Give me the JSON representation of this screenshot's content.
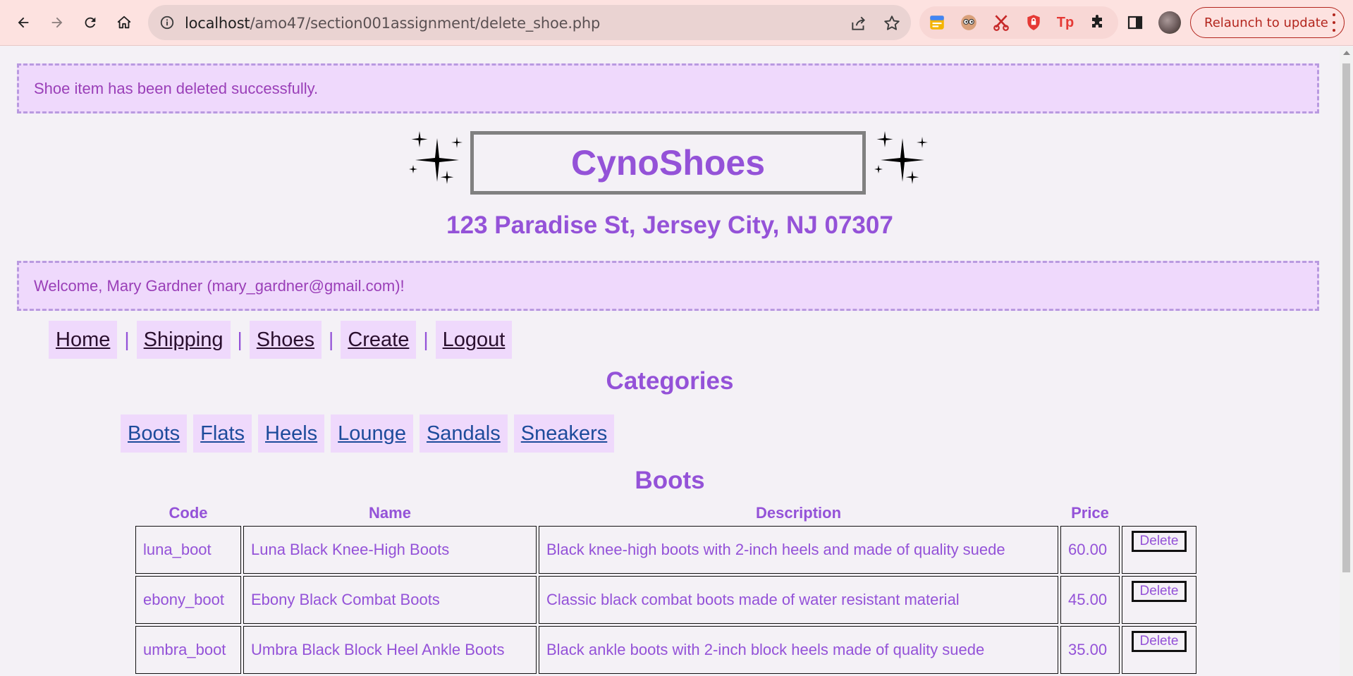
{
  "browser": {
    "url_host": "localhost",
    "url_path": "/amo47/section001assignment/delete_shoe.php",
    "relaunch_label": "Relaunch to update"
  },
  "notice": {
    "success": "Shoe item has been deleted successfully.",
    "welcome": "Welcome, Mary Gardner (mary_gardner@gmail.com)!"
  },
  "brand": {
    "name": "CynoShoes",
    "address": "123 Paradise St, Jersey City, NJ 07307"
  },
  "mainnav": {
    "home": "Home",
    "shipping": "Shipping",
    "shoes": "Shoes",
    "create": "Create",
    "logout": "Logout",
    "separator": "|"
  },
  "categories": {
    "title": "Categories",
    "items": [
      "Boots",
      "Flats",
      "Heels",
      "Lounge",
      "Sandals",
      "Sneakers"
    ]
  },
  "table": {
    "title": "Boots",
    "headers": [
      "Code",
      "Name",
      "Description",
      "Price"
    ],
    "rows": [
      [
        "luna_boot",
        "Luna Black Knee-High Boots",
        "Black knee-high boots with 2-inch heels and made of quality suede",
        "60.00"
      ],
      [
        "ebony_boot",
        "Ebony Black Combat Boots",
        "Classic black combat boots made of water resistant material",
        "45.00"
      ],
      [
        "umbra_boot",
        "Umbra Black Block Heel Ankle Boots",
        "Black ankle boots with 2-inch block heels made of quality suede",
        "35.00"
      ]
    ],
    "delete_label": "Delete"
  },
  "colors": {
    "accent": "#9452d8",
    "notice_bg": "#efd9fc",
    "chrome_bg": "#fde2e0",
    "relaunch": "#b3261e"
  }
}
